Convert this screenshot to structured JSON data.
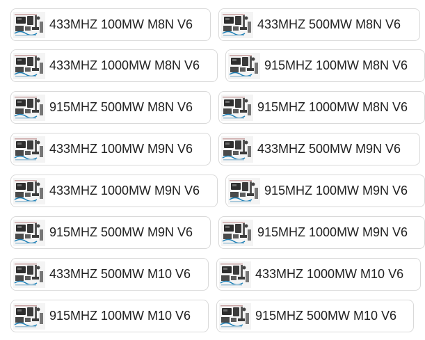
{
  "variants": [
    {
      "label": "433MHZ 100MW M8N V6"
    },
    {
      "label": "433MHZ 500MW M8N V6"
    },
    {
      "label": "433MHZ 1000MW M8N V6"
    },
    {
      "label": "915MHZ 100MW M8N V6"
    },
    {
      "label": "915MHZ 500MW M8N V6"
    },
    {
      "label": "915MHZ 1000MW M8N V6"
    },
    {
      "label": "433MHZ 100MW M9N V6"
    },
    {
      "label": "433MHZ 500MW M9N V6"
    },
    {
      "label": "433MHZ 1000MW M9N V6"
    },
    {
      "label": "915MHZ 100MW M9N V6"
    },
    {
      "label": "915MHZ 500MW M9N V6"
    },
    {
      "label": "915MHZ 1000MW M9N V6"
    },
    {
      "label": "433MHZ 500MW M10 V6"
    },
    {
      "label": "433MHZ 1000MW M10 V6"
    },
    {
      "label": "915MHZ 100MW M10 V6"
    },
    {
      "label": "915MHZ 500MW M10 V6"
    }
  ]
}
